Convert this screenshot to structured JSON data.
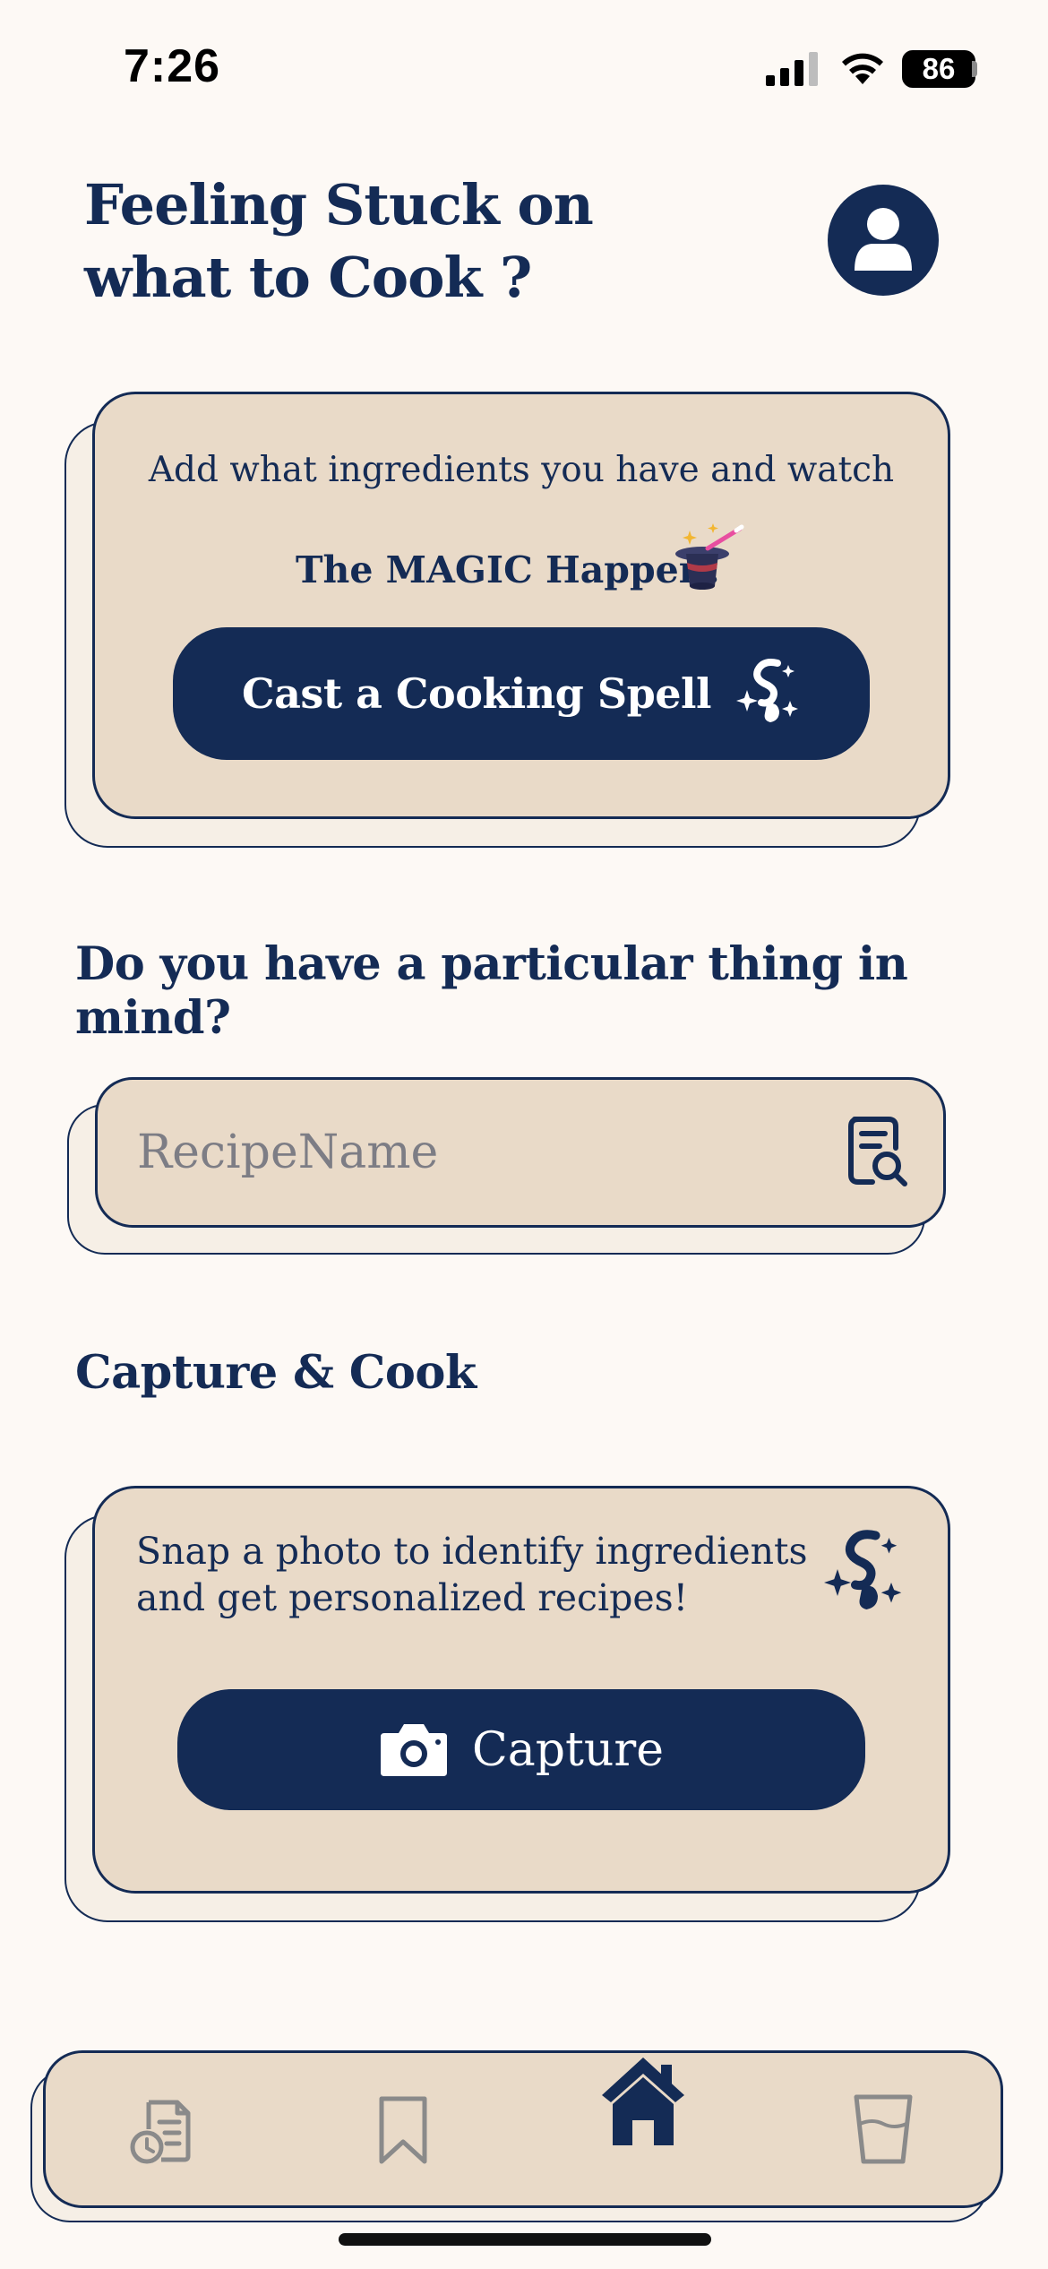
{
  "status_bar": {
    "time": "7:26",
    "battery": "86"
  },
  "header": {
    "title_line1": "Feeling Stuck on",
    "title_line2": "what to Cook ?"
  },
  "magic_card": {
    "line1": "Add what ingredients you have and watch",
    "line2": "The MAGIC Happen!",
    "button_label": "Cast a Cooking Spell"
  },
  "recipe_search": {
    "heading": "Do you have a particular thing in mind?",
    "placeholder": "RecipeName",
    "value": ""
  },
  "capture_card": {
    "heading": "Capture & Cook",
    "description": "Snap a photo to identify ingredients and get personalized recipes!",
    "button_label": "Capture"
  },
  "bottom_nav": {
    "items": [
      {
        "icon": "recipe-history-icon",
        "active": false
      },
      {
        "icon": "bookmark-icon",
        "active": false
      },
      {
        "icon": "home-icon",
        "active": true
      },
      {
        "icon": "glass-icon",
        "active": false
      }
    ]
  },
  "colors": {
    "navy": "#142b55",
    "card": "#e9dac8",
    "card_shadow": "#f6efe6",
    "background": "#fdf9f5",
    "inactive_icon": "#8a8a8a"
  }
}
